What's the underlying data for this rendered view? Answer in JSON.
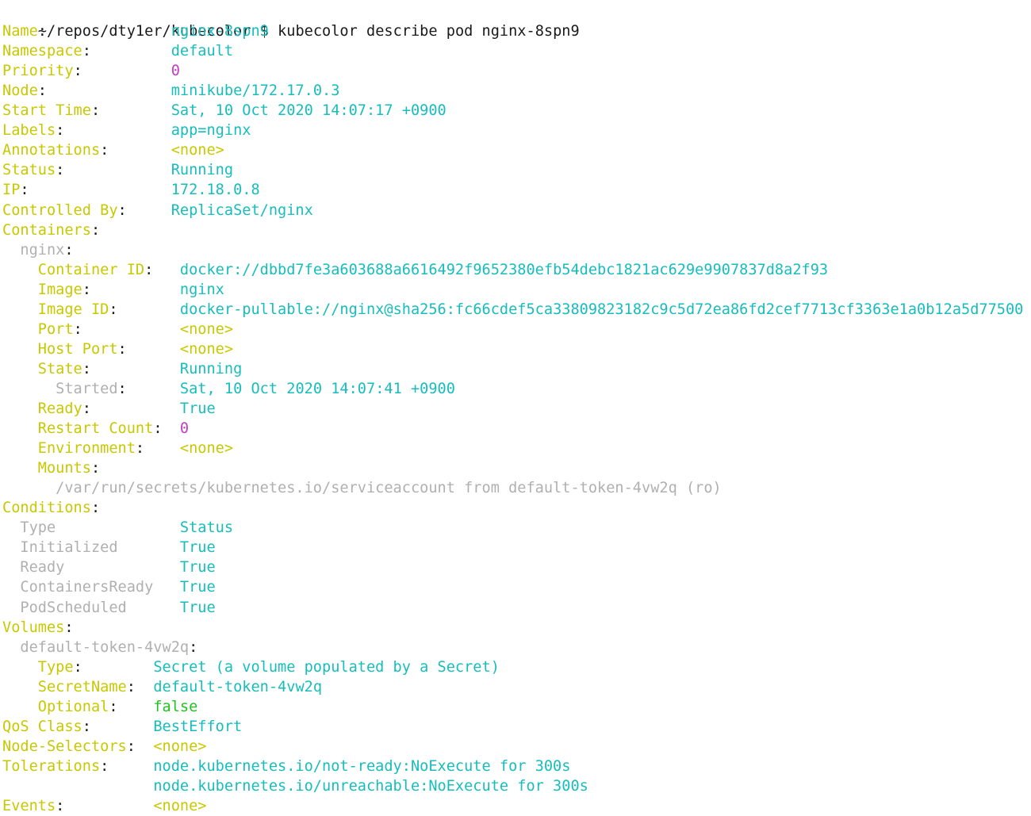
{
  "prompt": {
    "path": "~/repos/dty1er/kubecolor",
    "symbol": "$",
    "command": "kubecolor describe pod nginx-8spn9"
  },
  "lines": [
    {
      "segs": [
        {
          "t": "Name",
          "c": "key"
        },
        {
          "t": ":              ",
          "c": "plain"
        },
        {
          "t": "nginx-8spn9",
          "c": "val"
        }
      ]
    },
    {
      "segs": [
        {
          "t": "Namespace",
          "c": "key"
        },
        {
          "t": ":         ",
          "c": "plain"
        },
        {
          "t": "default",
          "c": "val"
        }
      ]
    },
    {
      "segs": [
        {
          "t": "Priority",
          "c": "key"
        },
        {
          "t": ":          ",
          "c": "plain"
        },
        {
          "t": "0",
          "c": "num"
        }
      ]
    },
    {
      "segs": [
        {
          "t": "Node",
          "c": "key"
        },
        {
          "t": ":              ",
          "c": "plain"
        },
        {
          "t": "minikube/172.17.0.3",
          "c": "val"
        }
      ]
    },
    {
      "segs": [
        {
          "t": "Start Time",
          "c": "key"
        },
        {
          "t": ":        ",
          "c": "plain"
        },
        {
          "t": "Sat, 10 Oct 2020 14:07:17 +0900",
          "c": "val"
        }
      ]
    },
    {
      "segs": [
        {
          "t": "Labels",
          "c": "key"
        },
        {
          "t": ":            ",
          "c": "plain"
        },
        {
          "t": "app=nginx",
          "c": "val"
        }
      ]
    },
    {
      "segs": [
        {
          "t": "Annotations",
          "c": "key"
        },
        {
          "t": ":       ",
          "c": "plain"
        },
        {
          "t": "<none>",
          "c": "key"
        }
      ]
    },
    {
      "segs": [
        {
          "t": "Status",
          "c": "key"
        },
        {
          "t": ":            ",
          "c": "plain"
        },
        {
          "t": "Running",
          "c": "val"
        }
      ]
    },
    {
      "segs": [
        {
          "t": "IP",
          "c": "key"
        },
        {
          "t": ":                ",
          "c": "plain"
        },
        {
          "t": "172.18.0.8",
          "c": "val"
        }
      ]
    },
    {
      "segs": [
        {
          "t": "Controlled By",
          "c": "key"
        },
        {
          "t": ":     ",
          "c": "plain"
        },
        {
          "t": "ReplicaSet/nginx",
          "c": "val"
        }
      ]
    },
    {
      "segs": [
        {
          "t": "Containers",
          "c": "key"
        },
        {
          "t": ":",
          "c": "plain"
        }
      ]
    },
    {
      "segs": [
        {
          "t": "  ",
          "c": "plain"
        },
        {
          "t": "nginx",
          "c": "gray"
        },
        {
          "t": ":",
          "c": "plain"
        }
      ]
    },
    {
      "segs": [
        {
          "t": "    ",
          "c": "plain"
        },
        {
          "t": "Container ID",
          "c": "key"
        },
        {
          "t": ":   ",
          "c": "plain"
        },
        {
          "t": "docker://dbbd7fe3a603688a6616492f9652380efb54debc1821ac629e9907837d8a2f93",
          "c": "val"
        }
      ]
    },
    {
      "segs": [
        {
          "t": "    ",
          "c": "plain"
        },
        {
          "t": "Image",
          "c": "key"
        },
        {
          "t": ":          ",
          "c": "plain"
        },
        {
          "t": "nginx",
          "c": "val"
        }
      ]
    },
    {
      "segs": [
        {
          "t": "    ",
          "c": "plain"
        },
        {
          "t": "Image ID",
          "c": "key"
        },
        {
          "t": ":       ",
          "c": "plain"
        },
        {
          "t": "docker-pullable://nginx@sha256:fc66cdef5ca33809823182c9c5d72ea86fd2cef7713cf3363e1a0b12a5d77500",
          "c": "val"
        }
      ]
    },
    {
      "segs": [
        {
          "t": "    ",
          "c": "plain"
        },
        {
          "t": "Port",
          "c": "key"
        },
        {
          "t": ":           ",
          "c": "plain"
        },
        {
          "t": "<none>",
          "c": "key"
        }
      ]
    },
    {
      "segs": [
        {
          "t": "    ",
          "c": "plain"
        },
        {
          "t": "Host Port",
          "c": "key"
        },
        {
          "t": ":      ",
          "c": "plain"
        },
        {
          "t": "<none>",
          "c": "key"
        }
      ]
    },
    {
      "segs": [
        {
          "t": "    ",
          "c": "plain"
        },
        {
          "t": "State",
          "c": "key"
        },
        {
          "t": ":          ",
          "c": "plain"
        },
        {
          "t": "Running",
          "c": "val"
        }
      ]
    },
    {
      "segs": [
        {
          "t": "      ",
          "c": "plain"
        },
        {
          "t": "Started",
          "c": "gray"
        },
        {
          "t": ":      ",
          "c": "plain"
        },
        {
          "t": "Sat, 10 Oct 2020 14:07:41 +0900",
          "c": "val"
        }
      ]
    },
    {
      "segs": [
        {
          "t": "    ",
          "c": "plain"
        },
        {
          "t": "Ready",
          "c": "key"
        },
        {
          "t": ":          ",
          "c": "plain"
        },
        {
          "t": "True",
          "c": "val"
        }
      ]
    },
    {
      "segs": [
        {
          "t": "    ",
          "c": "plain"
        },
        {
          "t": "Restart Count",
          "c": "key"
        },
        {
          "t": ":  ",
          "c": "plain"
        },
        {
          "t": "0",
          "c": "num"
        }
      ]
    },
    {
      "segs": [
        {
          "t": "    ",
          "c": "plain"
        },
        {
          "t": "Environment",
          "c": "key"
        },
        {
          "t": ":    ",
          "c": "plain"
        },
        {
          "t": "<none>",
          "c": "key"
        }
      ]
    },
    {
      "segs": [
        {
          "t": "    ",
          "c": "plain"
        },
        {
          "t": "Mounts",
          "c": "key"
        },
        {
          "t": ":",
          "c": "plain"
        }
      ]
    },
    {
      "segs": [
        {
          "t": "      ",
          "c": "plain"
        },
        {
          "t": "/var/run/secrets/kubernetes.io/serviceaccount from default-token-4vw2q (ro)",
          "c": "gray"
        }
      ]
    },
    {
      "segs": [
        {
          "t": "Conditions",
          "c": "key"
        },
        {
          "t": ":",
          "c": "plain"
        }
      ]
    },
    {
      "segs": [
        {
          "t": "  ",
          "c": "plain"
        },
        {
          "t": "Type",
          "c": "gray"
        },
        {
          "t": "              ",
          "c": "plain"
        },
        {
          "t": "Status",
          "c": "val"
        }
      ]
    },
    {
      "segs": [
        {
          "t": "  ",
          "c": "plain"
        },
        {
          "t": "Initialized",
          "c": "gray"
        },
        {
          "t": "       ",
          "c": "plain"
        },
        {
          "t": "True",
          "c": "val"
        }
      ]
    },
    {
      "segs": [
        {
          "t": "  ",
          "c": "plain"
        },
        {
          "t": "Ready",
          "c": "gray"
        },
        {
          "t": "             ",
          "c": "plain"
        },
        {
          "t": "True",
          "c": "val"
        }
      ]
    },
    {
      "segs": [
        {
          "t": "  ",
          "c": "plain"
        },
        {
          "t": "ContainersReady",
          "c": "gray"
        },
        {
          "t": "   ",
          "c": "plain"
        },
        {
          "t": "True",
          "c": "val"
        }
      ]
    },
    {
      "segs": [
        {
          "t": "  ",
          "c": "plain"
        },
        {
          "t": "PodScheduled",
          "c": "gray"
        },
        {
          "t": "      ",
          "c": "plain"
        },
        {
          "t": "True",
          "c": "val"
        }
      ]
    },
    {
      "segs": [
        {
          "t": "Volumes",
          "c": "key"
        },
        {
          "t": ":",
          "c": "plain"
        }
      ]
    },
    {
      "segs": [
        {
          "t": "  ",
          "c": "plain"
        },
        {
          "t": "default-token-4vw2q",
          "c": "gray"
        },
        {
          "t": ":",
          "c": "plain"
        }
      ]
    },
    {
      "segs": [
        {
          "t": "    ",
          "c": "plain"
        },
        {
          "t": "Type",
          "c": "key"
        },
        {
          "t": ":        ",
          "c": "plain"
        },
        {
          "t": "Secret (a volume populated by a Secret)",
          "c": "val"
        }
      ]
    },
    {
      "segs": [
        {
          "t": "    ",
          "c": "plain"
        },
        {
          "t": "SecretName",
          "c": "key"
        },
        {
          "t": ":  ",
          "c": "plain"
        },
        {
          "t": "default-token-4vw2q",
          "c": "val"
        }
      ]
    },
    {
      "segs": [
        {
          "t": "    ",
          "c": "plain"
        },
        {
          "t": "Optional",
          "c": "key"
        },
        {
          "t": ":    ",
          "c": "plain"
        },
        {
          "t": "false",
          "c": "green"
        }
      ]
    },
    {
      "segs": [
        {
          "t": "QoS Class",
          "c": "key"
        },
        {
          "t": ":       ",
          "c": "plain"
        },
        {
          "t": "BestEffort",
          "c": "val"
        }
      ]
    },
    {
      "segs": [
        {
          "t": "Node-Selectors",
          "c": "key"
        },
        {
          "t": ":  ",
          "c": "plain"
        },
        {
          "t": "<none>",
          "c": "key"
        }
      ]
    },
    {
      "segs": [
        {
          "t": "Tolerations",
          "c": "key"
        },
        {
          "t": ":     ",
          "c": "plain"
        },
        {
          "t": "node.kubernetes.io/not-ready:NoExecute for 300s",
          "c": "val"
        }
      ]
    },
    {
      "segs": [
        {
          "t": "                 ",
          "c": "plain"
        },
        {
          "t": "node.kubernetes.io/unreachable:NoExecute for 300s",
          "c": "val"
        }
      ]
    },
    {
      "segs": [
        {
          "t": "Events",
          "c": "key"
        },
        {
          "t": ":          ",
          "c": "plain"
        },
        {
          "t": "<none>",
          "c": "key"
        }
      ]
    }
  ],
  "colors": {
    "key": "#c8c800",
    "val": "#17bdbd",
    "num": "#c53cc5",
    "gray": "#b0b0b0",
    "green": "#1fc21f",
    "plain": "#1a1a1a",
    "background": "#ffffff"
  }
}
